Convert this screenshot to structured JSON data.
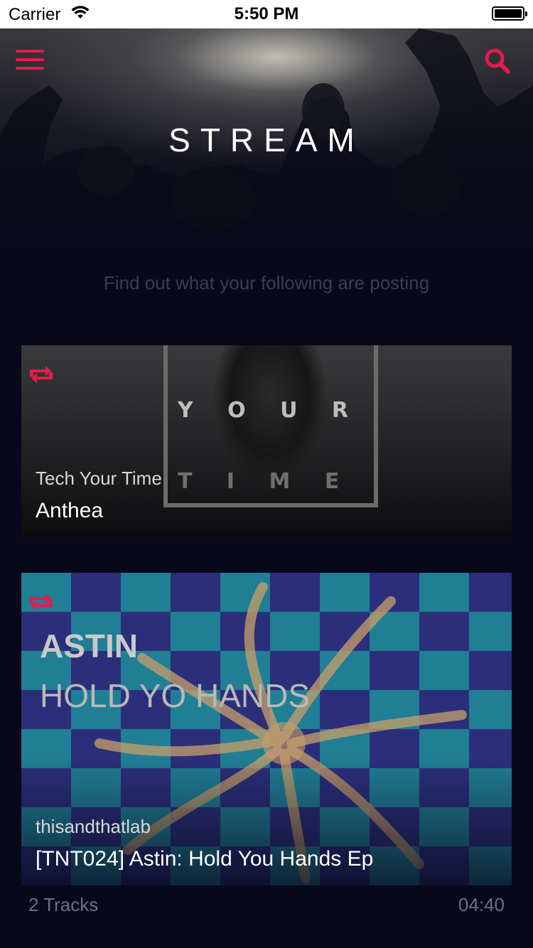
{
  "status_bar": {
    "carrier": "Carrier",
    "time": "5:50 PM",
    "wifi_icon": "wifi-icon",
    "battery_level": 1.0
  },
  "header": {
    "title": "STREAM",
    "subtitle": "Find out what your following are posting",
    "menu_icon": "hamburger-menu-icon",
    "search_icon": "search-icon",
    "accent_color": "#e51c4f"
  },
  "stream": [
    {
      "user": "Tech Your Time",
      "track": "Anthea",
      "artwork_text": [
        "Y O U R",
        "T I M E"
      ],
      "repost_icon": "repost-icon"
    },
    {
      "user": "thisandthatlab",
      "track": "[TNT024] Astin: Hold You Hands Ep",
      "artwork_text": [
        "ASTIN",
        "HOLD YO HANDS"
      ],
      "repost_icon": "repost-icon",
      "tracks_count": "2 Tracks",
      "duration": "04:40"
    }
  ],
  "colors": {
    "background": "#07081a",
    "subtitle": "#3a3c58",
    "meta": "#6d6f86"
  }
}
